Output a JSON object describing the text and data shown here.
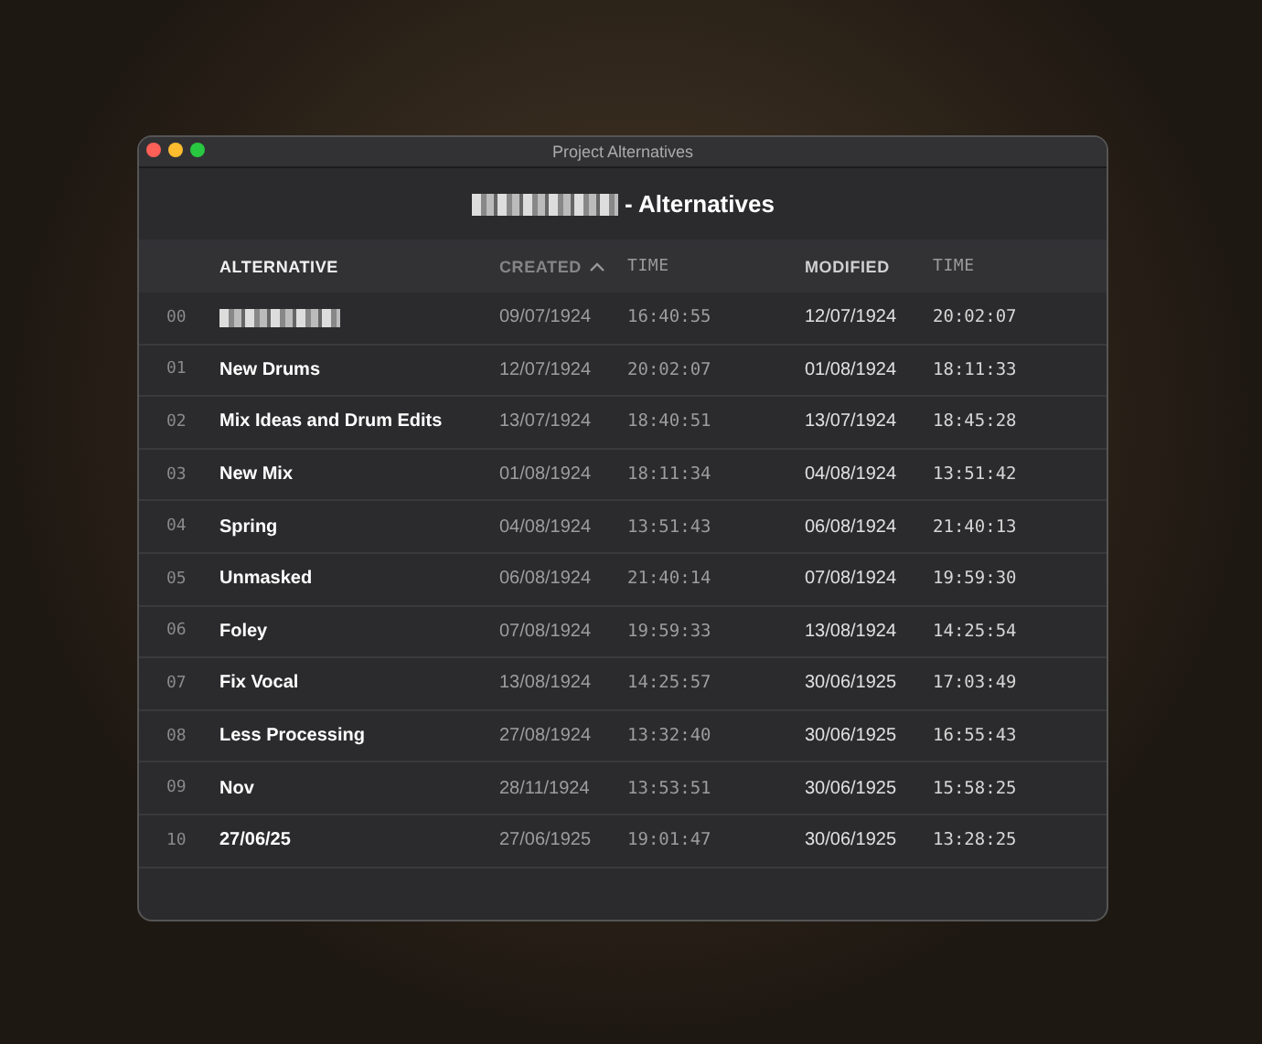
{
  "window": {
    "title": "Project Alternatives"
  },
  "heading": {
    "redacted": true,
    "text": "- Alternatives"
  },
  "table": {
    "columns": [
      {
        "label": "ALTERNATIVE",
        "sorted": false
      },
      {
        "label": "CREATED",
        "sorted": true
      },
      {
        "label": "TIME",
        "sorted": false
      },
      {
        "label": "MODIFIED",
        "sorted": false
      },
      {
        "label": "TIME",
        "sorted": false
      }
    ],
    "rows": [
      {
        "index": "00",
        "redacted": true,
        "created": "09/07/1924",
        "created_time": "16:40:55",
        "modified": "12/07/1924",
        "modified_time": "20:02:07"
      },
      {
        "index": "01",
        "redacted": false,
        "name": "New Drums",
        "created": "12/07/1924",
        "created_time": "20:02:07",
        "modified": "01/08/1924",
        "modified_time": "18:11:33"
      },
      {
        "index": "02",
        "redacted": false,
        "name": "Mix Ideas and Drum Edits",
        "created": "13/07/1924",
        "created_time": "18:40:51",
        "modified": "13/07/1924",
        "modified_time": "18:45:28"
      },
      {
        "index": "03",
        "redacted": false,
        "name": "New Mix",
        "created": "01/08/1924",
        "created_time": "18:11:34",
        "modified": "04/08/1924",
        "modified_time": "13:51:42"
      },
      {
        "index": "04",
        "redacted": false,
        "name": "Spring",
        "created": "04/08/1924",
        "created_time": "13:51:43",
        "modified": "06/08/1924",
        "modified_time": "21:40:13"
      },
      {
        "index": "05",
        "redacted": false,
        "name": "Unmasked",
        "created": "06/08/1924",
        "created_time": "21:40:14",
        "modified": "07/08/1924",
        "modified_time": "19:59:30"
      },
      {
        "index": "06",
        "redacted": false,
        "name": "Foley",
        "created": "07/08/1924",
        "created_time": "19:59:33",
        "modified": "13/08/1924",
        "modified_time": "14:25:54"
      },
      {
        "index": "07",
        "redacted": false,
        "name": "Fix Vocal",
        "created": "13/08/1924",
        "created_time": "14:25:57",
        "modified": "30/06/1925",
        "modified_time": "17:03:49"
      },
      {
        "index": "08",
        "redacted": false,
        "name": "Less Processing",
        "created": "27/08/1924",
        "created_time": "13:32:40",
        "modified": "30/06/1925",
        "modified_time": "16:55:43"
      },
      {
        "index": "09",
        "redacted": false,
        "name": "Nov",
        "created": "28/11/1924",
        "created_time": "13:53:51",
        "modified": "30/06/1925",
        "modified_time": "15:58:25"
      },
      {
        "index": "10",
        "redacted": false,
        "name": "27/06/25",
        "created": "27/06/1925",
        "created_time": "19:01:47",
        "modified": "30/06/1925",
        "modified_time": "13:28:25"
      }
    ]
  }
}
